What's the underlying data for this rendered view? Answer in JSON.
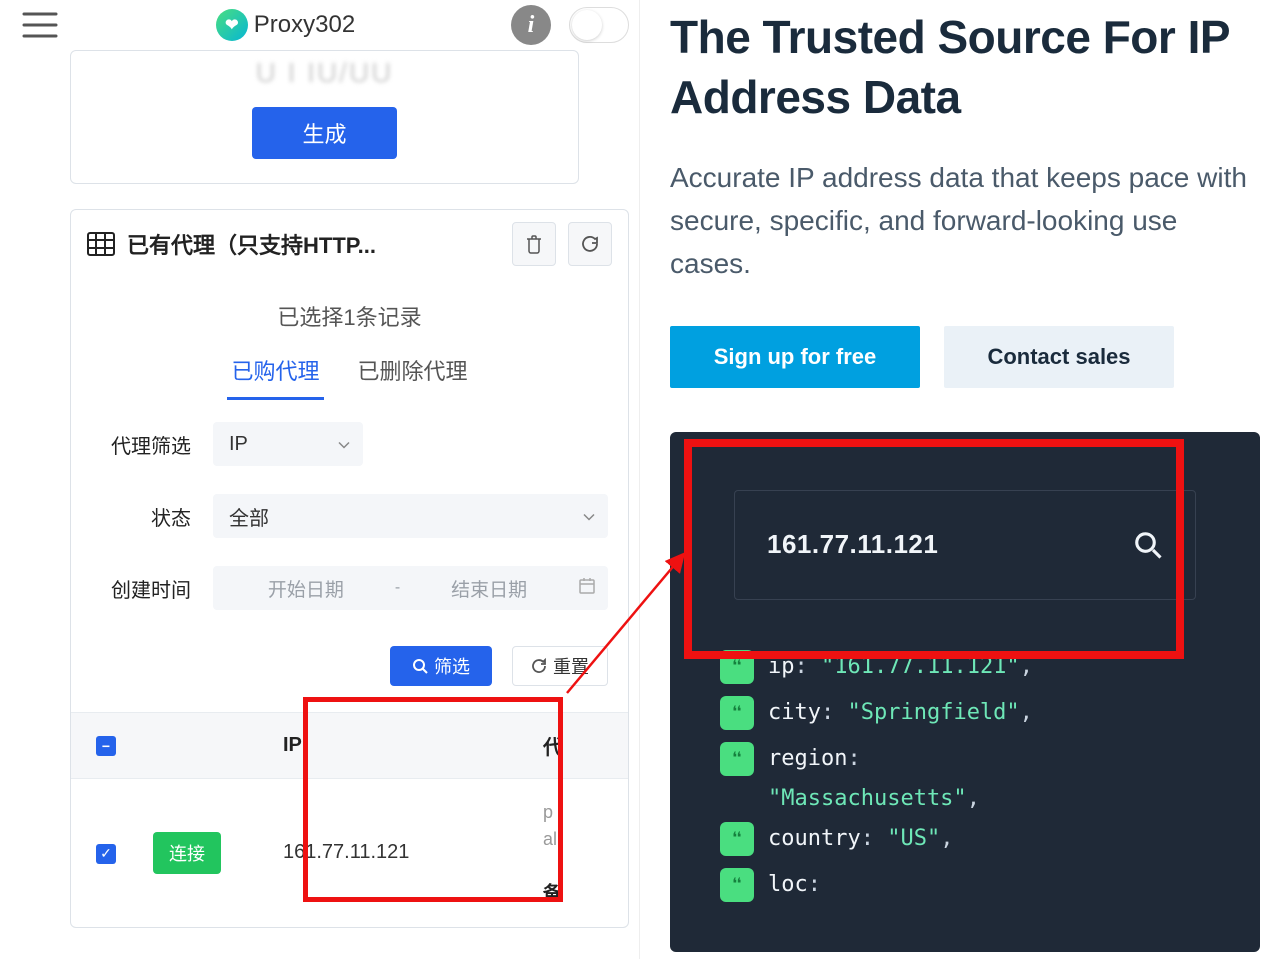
{
  "header": {
    "brand": "Proxy302"
  },
  "left": {
    "price_placeholder": "U I IU/UU",
    "generate_btn": "生成",
    "proxy_panel_title": "已有代理（只支持HTTP...",
    "selected_text": "已选择1条记录",
    "tab_purchased": "已购代理",
    "tab_deleted": "已删除代理",
    "filter_label": "代理筛选",
    "filter_ip": "IP",
    "status_label": "状态",
    "status_all": "全部",
    "create_time_label": "创建时间",
    "start_date": "开始日期",
    "end_date": "结束日期",
    "btn_filter": "筛选",
    "btn_reset": "重置",
    "col_ip": "IP",
    "col_extra_hdr": "代",
    "connect": "连接",
    "row_ip": "161.77.11.121",
    "row_extra1": "p",
    "row_extra2": "al",
    "row_extra3": "备"
  },
  "right": {
    "title": "The Trusted Source For IP Address Data",
    "subtitle": "Accurate IP address data that keeps pace with secure, specific, and forward-looking use cases.",
    "signup": "Sign up for free",
    "contact": "Contact sales",
    "search_ip": "161.77.11.121",
    "json": {
      "ip_key": "ip",
      "ip_val": "\"161.77.11.121\"",
      "city_key": "city",
      "city_val": "\"Springfield\"",
      "region_key": "region",
      "region_val": "\"Massachusetts\"",
      "country_key": "country",
      "country_val": "\"US\"",
      "loc_key": "loc"
    }
  }
}
